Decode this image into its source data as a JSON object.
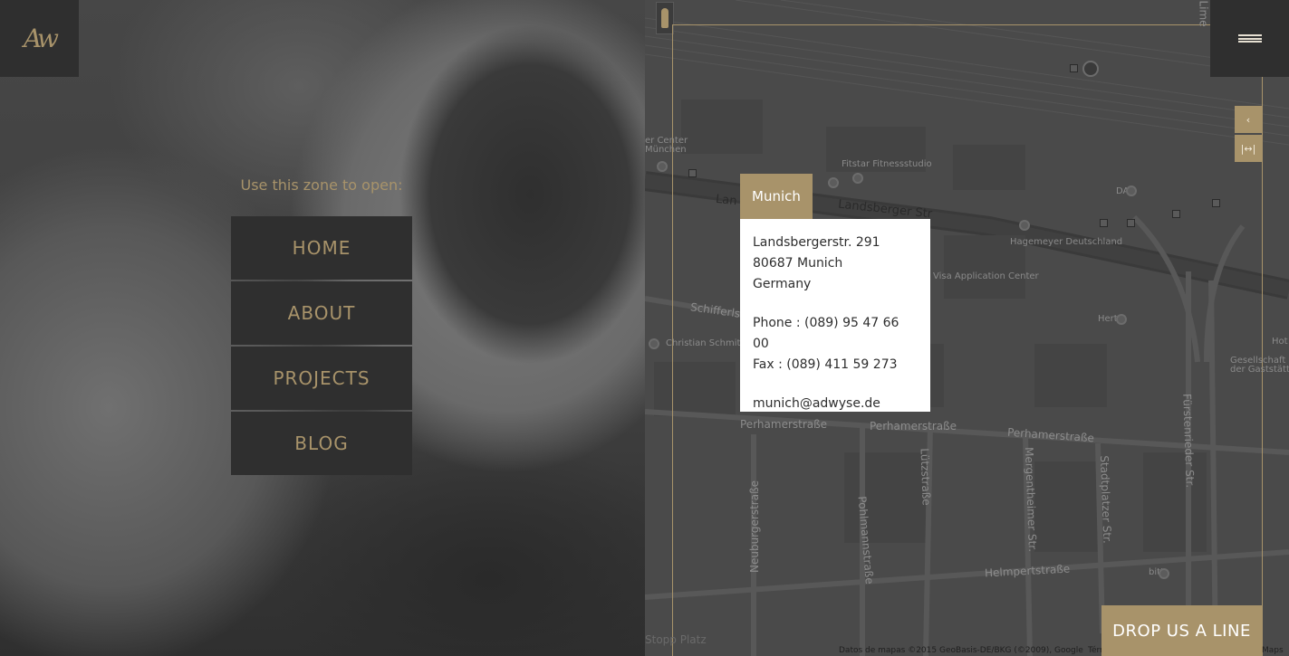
{
  "logo": {
    "text": "Aw"
  },
  "left": {
    "zone_label": "Use this zone to open:",
    "menu": [
      {
        "label": "HOME"
      },
      {
        "label": "ABOUT"
      },
      {
        "label": "PROJECTS"
      },
      {
        "label": "BLOG"
      }
    ]
  },
  "map": {
    "controls": {
      "back": "‹",
      "expand": "|↔|"
    },
    "streets": {
      "landsberger_1": "Landsberger Str",
      "landsberger_2": "Lan",
      "perhamer_1": "Perhamerstraße",
      "perhamer_2": "Perhamerstraße",
      "perhamer_3": "Perhamerstraße",
      "schifferle": "Schifferls",
      "luetzstrasse": "Lützstraße",
      "mergentheimer": "Mergentheimer Str.",
      "stadtplatzer": "Stadtplatzer Str.",
      "fuerstenrieder": "Fürstenrieder Str.",
      "neuburger": "Neuburgerstraße",
      "pohlmann": "Pohlmannstraße",
      "helmpert": "Helmpertstraße",
      "top_right": "Lime"
    },
    "pois": {
      "fitstar": "Fitstar Fitnessstudio",
      "daf": "DAB",
      "hagemeyer": "Hagemeyer Deutschland",
      "visa": "Visa Application Center",
      "hertz": "Hertz",
      "christian": "Christian Schmit",
      "gesellschaft": "Gesellschaft der Gaststätt",
      "center": "er Center München",
      "hotel": "Hot",
      "bitt": "bitt",
      "bl": "Stopp Platz"
    },
    "footer": "Datos de mapas ©2015 GeoBasis-DE/BKG (©2009), Google",
    "footer_terms": "Térm",
    "footer_maps": "Maps"
  },
  "infowindow": {
    "tab": "Munich",
    "address_line1": "Landsbergerstr. 291",
    "address_line2": "80687 Munich",
    "country": "Germany",
    "phone": "Phone : (089) 95 47 66 00",
    "fax": "Fax : (089) 411 59 273",
    "email": "munich@adwyse.de"
  },
  "cta": {
    "label": "DROP US A LINE"
  },
  "colors": {
    "accent": "#a8936a",
    "dark": "#2f2f2f"
  }
}
